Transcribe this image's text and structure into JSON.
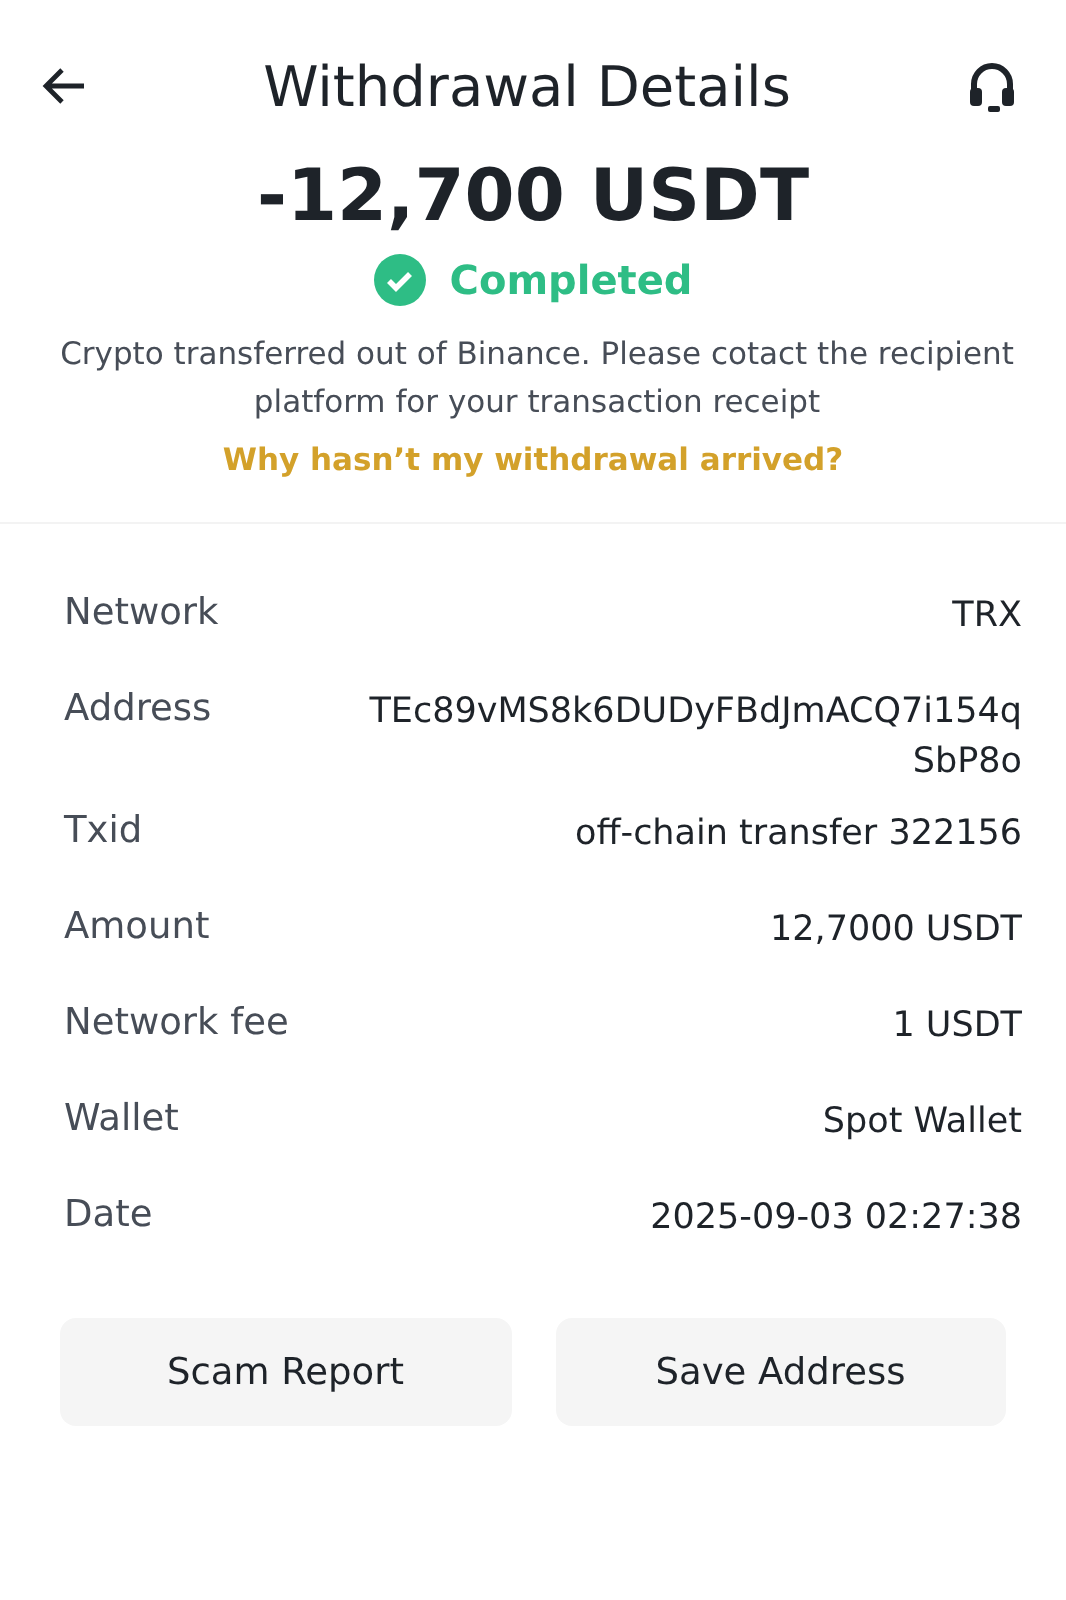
{
  "header": {
    "title": "Withdrawal Details"
  },
  "amount": "-12,700 USDT",
  "status": {
    "label": "Completed",
    "kind": "success"
  },
  "message": "Crypto transferred out of Binance. Please cotact the recipient platform for your transaction receipt",
  "help_link": "Why hasn’t my withdrawal arrived?",
  "details": [
    {
      "label": "Network",
      "value_lines": [
        "TRX"
      ]
    },
    {
      "label": "Address",
      "value_lines": [
        "TEc89vMS8k6DUDyFBdJmACQ7i154q",
        "SbP8o"
      ]
    },
    {
      "label": "Txid",
      "value_lines": [
        "off-chain transfer 322156"
      ]
    },
    {
      "label": "Amount",
      "value_lines": [
        "12,7000 USDT"
      ]
    },
    {
      "label": "Network fee",
      "value_lines": [
        "1 USDT"
      ]
    },
    {
      "label": "Wallet",
      "value_lines": [
        "Spot Wallet"
      ]
    },
    {
      "label": "Date",
      "value_lines": [
        "2025-09-03 02:27:38"
      ]
    }
  ],
  "buttons": [
    "Scam Report",
    "Save Address"
  ]
}
